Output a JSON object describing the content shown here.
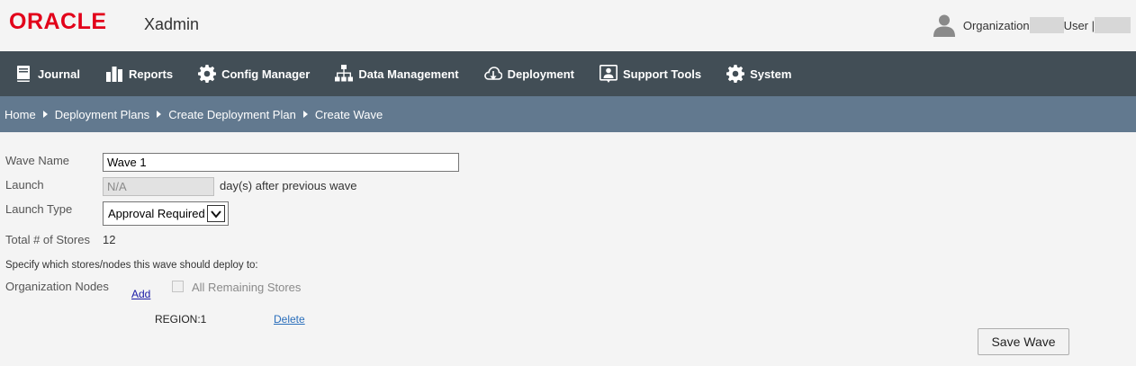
{
  "header": {
    "logo_text": "ORACLE",
    "app_name": "Xadmin",
    "organization_label": "Organization",
    "user_label": "User |"
  },
  "nav": {
    "items": [
      {
        "label": "Journal",
        "icon": "book-icon"
      },
      {
        "label": "Reports",
        "icon": "bar-chart-icon"
      },
      {
        "label": "Config Manager",
        "icon": "gear-icon"
      },
      {
        "label": "Data Management",
        "icon": "hierarchy-icon"
      },
      {
        "label": "Deployment",
        "icon": "cloud-download-icon"
      },
      {
        "label": "Support Tools",
        "icon": "support-user-icon"
      },
      {
        "label": "System",
        "icon": "gear-icon"
      }
    ]
  },
  "breadcrumb": [
    "Home",
    "Deployment Plans",
    "Create Deployment Plan",
    "Create Wave"
  ],
  "form": {
    "wave_name_label": "Wave Name",
    "wave_name_value": "Wave 1",
    "launch_label": "Launch",
    "launch_value": "N/A",
    "launch_suffix": "day(s) after previous wave",
    "launch_type_label": "Launch Type",
    "launch_type_selected": "Approval Required",
    "total_stores_label": "Total # of Stores",
    "total_stores_value": "12",
    "instructions": "Specify which stores/nodes this wave should deploy to:",
    "org_nodes_label": "Organization Nodes",
    "add_link": "Add",
    "all_remaining_label": "All Remaining Stores",
    "all_remaining_checked": false,
    "nodes": [
      {
        "name": "REGION:1",
        "delete_label": "Delete"
      }
    ],
    "save_button": "Save Wave"
  },
  "colors": {
    "brand_red": "#e2001a",
    "navbar_bg": "#424e56",
    "breadcrumb_bg": "#62798f",
    "page_bg": "#f4f4f4"
  }
}
